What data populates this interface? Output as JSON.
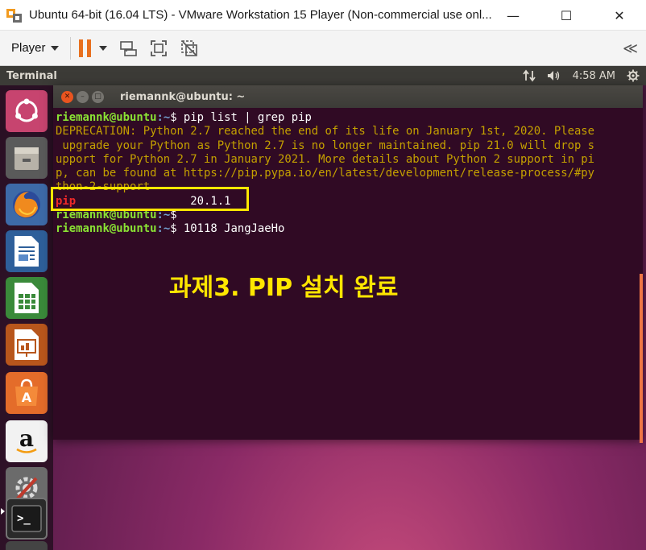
{
  "window": {
    "title": "Ubuntu 64-bit (16.04 LTS) - VMware Workstation 15 Player (Non-commercial use onl...",
    "controls": {
      "minimize": "—",
      "maximize": "☐",
      "close": "✕"
    }
  },
  "toolbar": {
    "player_label": "Player",
    "icons": [
      "pause-icon",
      "dropdown-icon",
      "send-ctrl-alt-del-icon",
      "fit-guest-icon",
      "unity-icon",
      "collapse-icon"
    ],
    "collapse_glyph": "≪",
    "accent_color": "#e8701f"
  },
  "panel": {
    "app_name": "Terminal",
    "time": "4:58 AM",
    "icons": [
      "network-icon",
      "volume-icon",
      "settings-gear-icon"
    ]
  },
  "launcher": {
    "items": [
      "dash-icon",
      "files-icon",
      "firefox-icon",
      "writer-icon",
      "calc-icon",
      "impress-icon",
      "software-center-icon",
      "amazon-icon",
      "system-settings-icon",
      "terminal-icon",
      "extra-icon"
    ]
  },
  "terminal": {
    "title": "riemannk@ubuntu: ~",
    "prompt_user": "riemannk@ubuntu",
    "prompt_path": ":~",
    "prompt_sign": "$ ",
    "command1": "pip list | grep pip",
    "deprecation_lines": [
      "DEPRECATION: Python 2.7 reached the end of its life on January 1st, 2020. Please",
      " upgrade your Python as Python 2.7 is no longer maintained. pip 21.0 will drop s",
      "upport for Python 2.7 in January 2021. More details about Python 2 support in pi",
      "p, can be found at https://pip.pypa.io/en/latest/development/release-process/#py",
      "thon-2-support"
    ],
    "pip_name": "pip",
    "pip_pad": "                 ",
    "pip_version": "20.1.1",
    "command3": "10118 JangJaeHo"
  },
  "overlay": {
    "caption": "과제3. PIP 설치 완료",
    "caption_color": "#ffe600"
  }
}
